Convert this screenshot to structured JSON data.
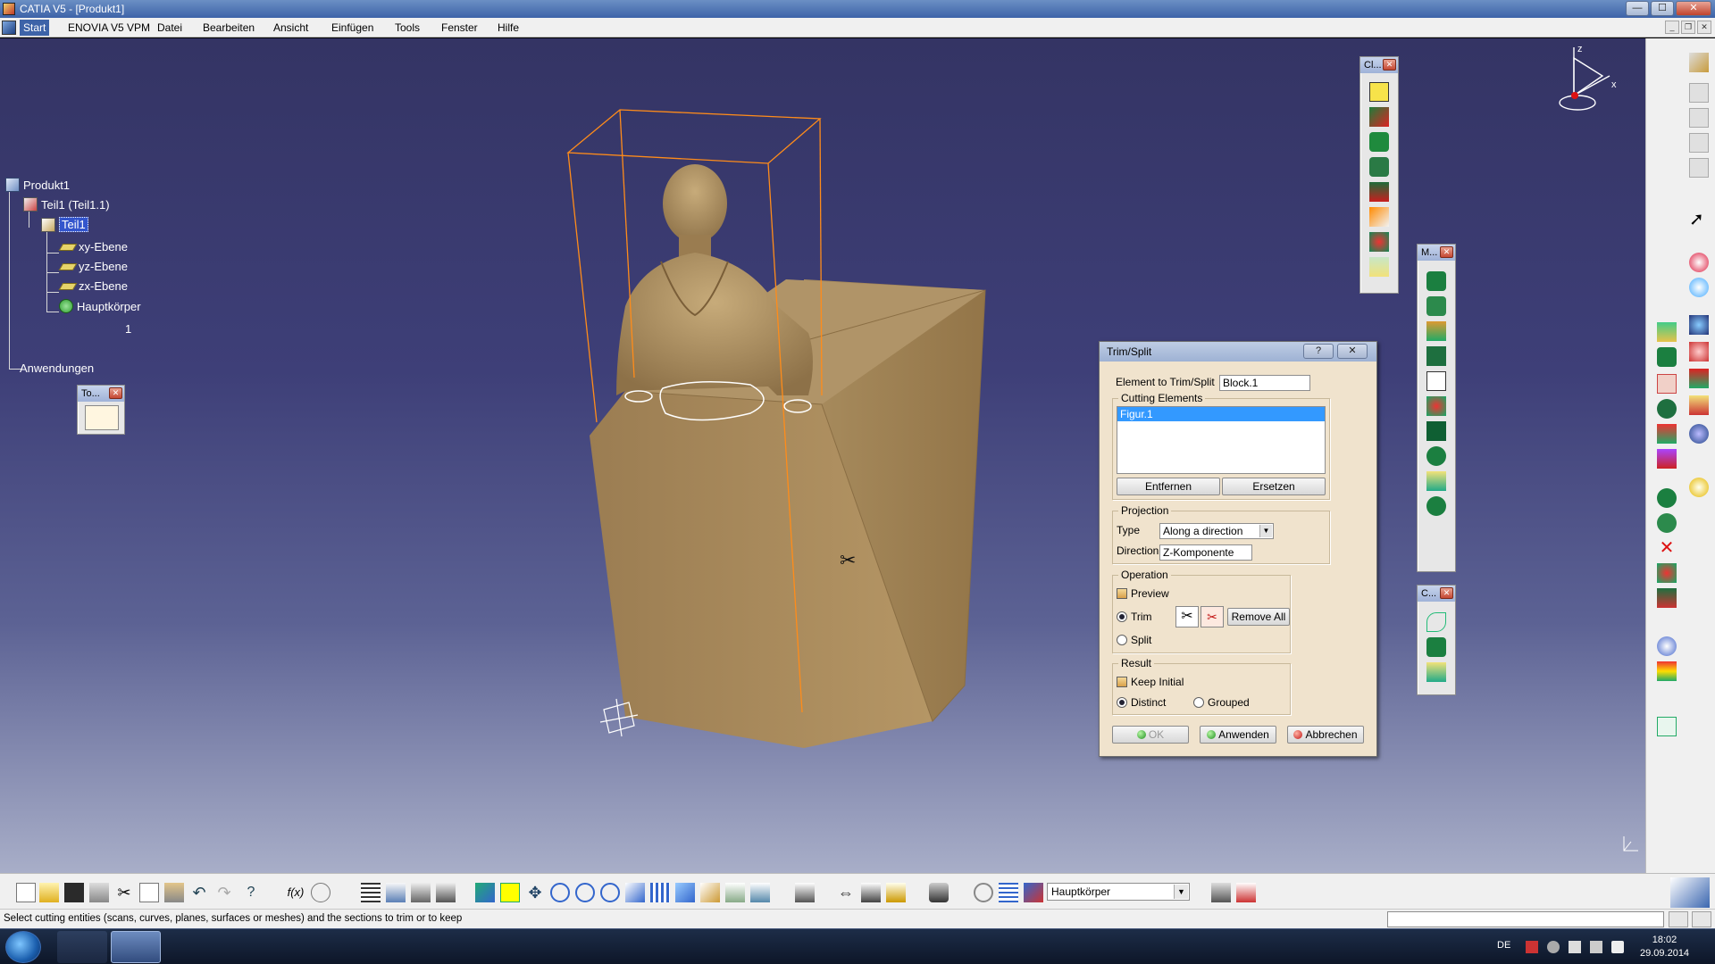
{
  "window": {
    "title": "CATIA V5 - [Produkt1]",
    "minimize": "—",
    "maximize": "☐",
    "close": "✕"
  },
  "menu": {
    "items": [
      "Start",
      "ENOVIA V5 VPM",
      "Datei",
      "Bearbeiten",
      "Ansicht",
      "Einfügen",
      "Tools",
      "Fenster",
      "Hilfe"
    ],
    "mdi_min": "_",
    "mdi_restore": "❐",
    "mdi_close": "✕"
  },
  "tree": {
    "root": "Produkt1",
    "part": "Teil1 (Teil1.1)",
    "part_body": "Teil1",
    "planes": [
      "xy-Ebene",
      "yz-Ebene",
      "zx-Ebene"
    ],
    "main_body": "Hauptkörper",
    "hidden_child": "1",
    "applications": "Anwendungen"
  },
  "mini_toolbars": {
    "cl": "Cl...",
    "m": "M...",
    "c": "C...",
    "to": "To..."
  },
  "axis_labels": {
    "x": "x",
    "z": "z"
  },
  "dialog": {
    "title": "Trim/Split",
    "help": "?",
    "close": "✕",
    "element_label": "Element to Trim/Split",
    "element_value": "Block.1",
    "cutting_group": "Cutting Elements",
    "cutting_items": [
      "Figur.1"
    ],
    "remove_btn": "Entfernen",
    "replace_btn": "Ersetzen",
    "projection_group": "Projection",
    "type_label": "Type",
    "type_value": "Along a direction",
    "direction_label": "Direction",
    "direction_value": "Z-Komponente",
    "operation_group": "Operation",
    "preview_label": "Preview",
    "trim_label": "Trim",
    "remove_all_btn": "Remove All",
    "split_label": "Split",
    "result_group": "Result",
    "keep_initial_label": "Keep Initial",
    "distinct_label": "Distinct",
    "grouped_label": "Grouped",
    "ok_btn": "OK",
    "apply_btn": "Anwenden",
    "cancel_btn": "Abbrechen",
    "operation_selected": "Trim",
    "result_selected": "Distinct"
  },
  "bottom": {
    "body_select": "Hauptkörper"
  },
  "status": {
    "message": "Select cutting entities (scans, curves, planes, surfaces or meshes) and the sections to trim or to keep"
  },
  "taskbar": {
    "lang": "DE",
    "time": "18:02",
    "date": "29.09.2014"
  },
  "colors": {
    "viewport_top": "#343464",
    "model": "#a88c5e",
    "bbox": "#ff8c1a",
    "dialog_bg": "#f0e3cd"
  }
}
